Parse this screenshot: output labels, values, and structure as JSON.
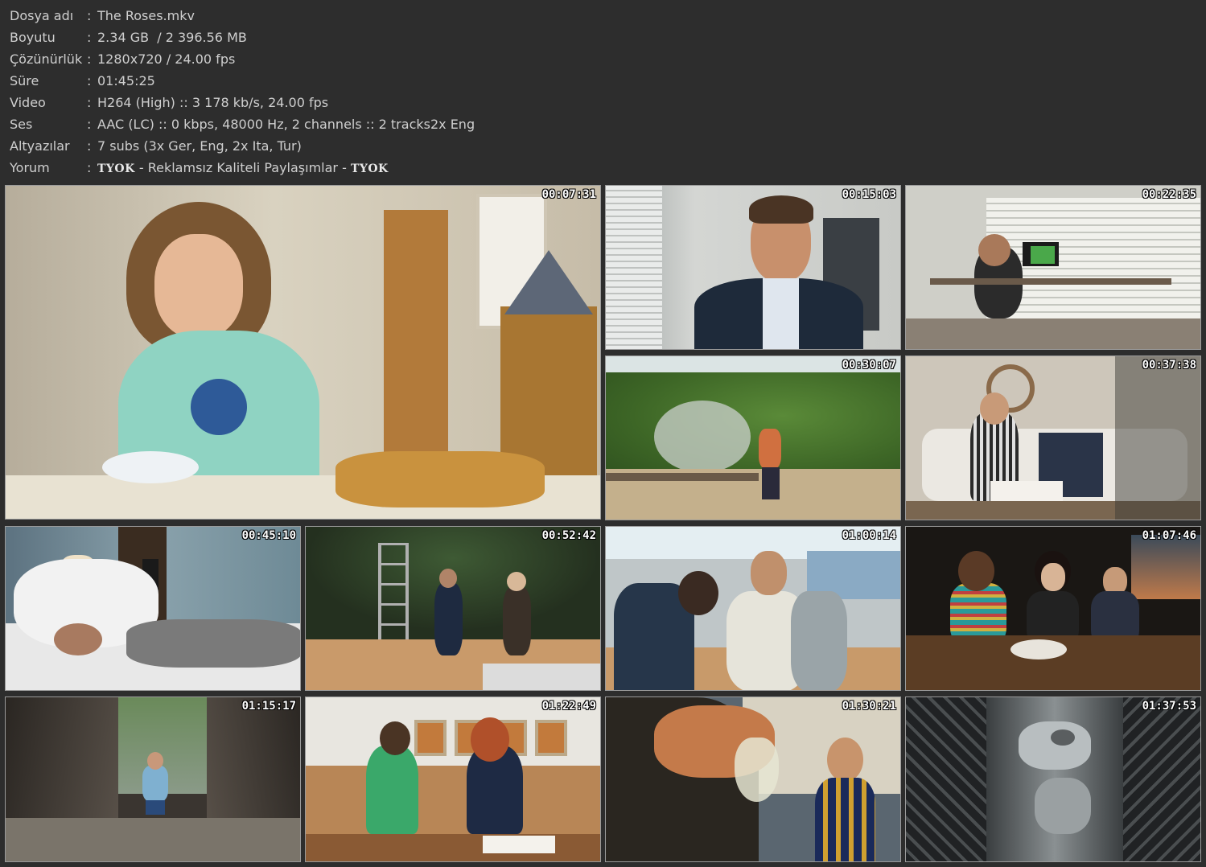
{
  "info": {
    "rows": [
      {
        "label": "Dosya adı",
        "sep": ":",
        "value": "The Roses.mkv"
      },
      {
        "label": "Boyutu",
        "sep": ":",
        "value": "2.34 GB  / 2 396.56 MB"
      },
      {
        "label": "Çözünürlük",
        "sep": ":",
        "value": "1280x720 / 24.00 fps"
      },
      {
        "label": "Süre",
        "sep": ":",
        "value": "01:45:25"
      },
      {
        "label": "Video",
        "sep": ":",
        "value": "H264 (High) :: 3 178 kb/s, 24.00 fps"
      },
      {
        "label": "Ses",
        "sep": ":",
        "value": "AAC (LC) :: 0 kbps, 48000 Hz, 2 channels :: 2 tracks2x Eng"
      },
      {
        "label": "Altyazılar",
        "sep": ":",
        "value": "7 subs (3x Ger, Eng, 2x Ita, Tur)"
      }
    ],
    "comment": {
      "label": "Yorum",
      "sep": ":",
      "brand_left": "TYOK",
      "middle": " - Reklamsız Kaliteli Paylaşımlar - ",
      "brand_right": "TYOK"
    }
  },
  "thumbnails": [
    {
      "timestamp": "00:07:31",
      "palette": [
        "#cfc7b4",
        "#8fd3c2",
        "#b8863f"
      ]
    },
    {
      "timestamp": "00:15:03",
      "palette": [
        "#cfd2cf",
        "#1e2a3a",
        "#c08a6c"
      ]
    },
    {
      "timestamp": "00:22:35",
      "palette": [
        "#d8d8d2",
        "#2a2a2a",
        "#4aa84a"
      ]
    },
    {
      "timestamp": "00:30:07",
      "palette": [
        "#4f7a32",
        "#b9a886",
        "#d07040"
      ]
    },
    {
      "timestamp": "00:37:38",
      "palette": [
        "#cfc8bd",
        "#e0ddd6",
        "#5a5a5a"
      ]
    },
    {
      "timestamp": "00:45:10",
      "palette": [
        "#6e8a96",
        "#e8e8e8",
        "#7a7a7a"
      ]
    },
    {
      "timestamp": "00:52:42",
      "palette": [
        "#2c3a2a",
        "#c99a6a",
        "#b0b0b0"
      ]
    },
    {
      "timestamp": "01:00:14",
      "palette": [
        "#bfc6c8",
        "#cfcfc4",
        "#26364a"
      ]
    },
    {
      "timestamp": "01:07:46",
      "palette": [
        "#1a1714",
        "#5b3d24",
        "#2a9a9a"
      ]
    },
    {
      "timestamp": "01:15:17",
      "palette": [
        "#3a3530",
        "#9aa6a0",
        "#7fb0d0"
      ]
    },
    {
      "timestamp": "01:22:49",
      "palette": [
        "#e8e6e0",
        "#c27a3c",
        "#3aa86a"
      ]
    },
    {
      "timestamp": "01:30:21",
      "palette": [
        "#2a2620",
        "#d8d2c2",
        "#c46a2a"
      ]
    },
    {
      "timestamp": "01:37:53",
      "palette": [
        "#5a5e60",
        "#9aa0a2",
        "#202224"
      ]
    }
  ]
}
